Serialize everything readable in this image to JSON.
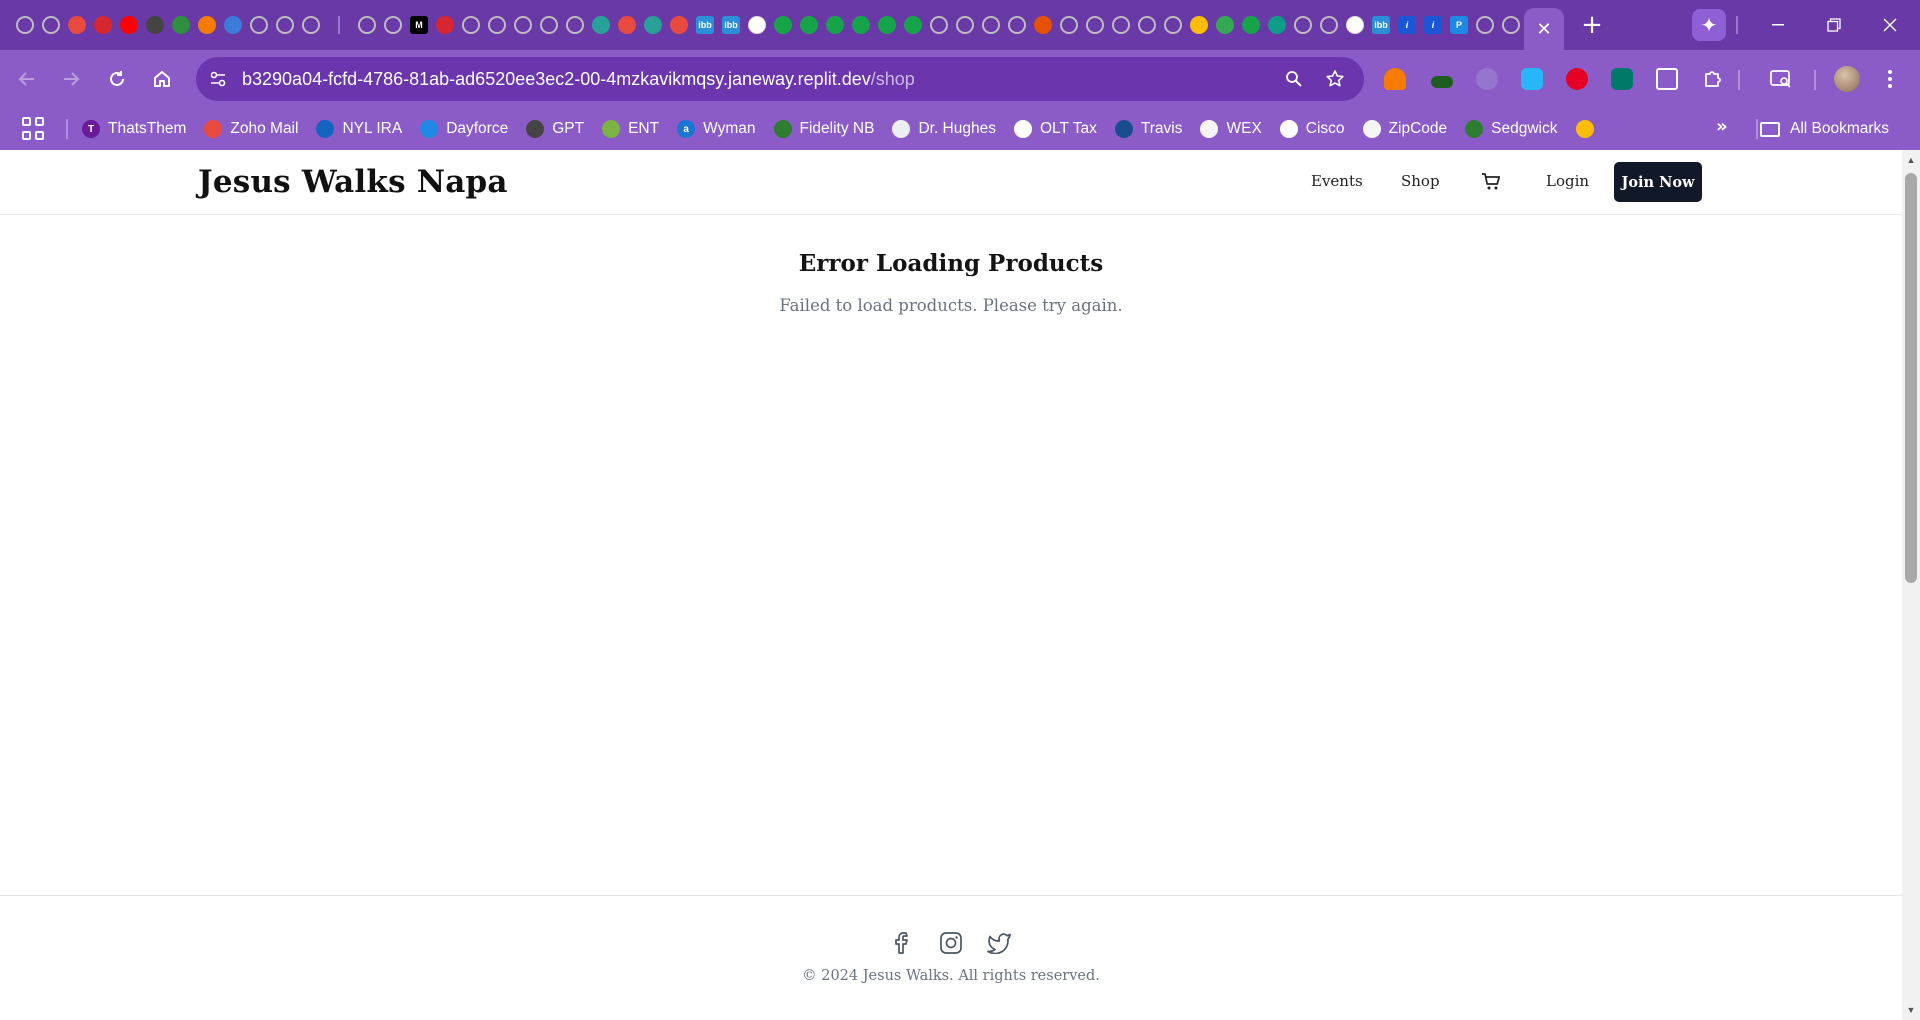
{
  "browser": {
    "tab_favicons": [
      {
        "icon": "chrome-icon",
        "color": "#8a8a8a"
      },
      {
        "icon": "chrome-icon",
        "color": "#8a8a8a"
      },
      {
        "icon": "zoho-mail-icon",
        "color": "#e94a3f"
      },
      {
        "icon": "nascar-icon",
        "color": "#d8262e"
      },
      {
        "icon": "youtube-icon",
        "color": "#ff0000"
      },
      {
        "icon": "diamond-icon",
        "color": "#444444"
      },
      {
        "icon": "shield-icon",
        "color": "#2f8f3e"
      },
      {
        "icon": "star-icon",
        "color": "#f57c00"
      },
      {
        "icon": "globe-icon",
        "color": "#3d7bd9"
      },
      {
        "icon": "chrome-icon",
        "color": "#8a8a8a"
      },
      {
        "icon": "chrome-icon",
        "color": "#8a8a8a"
      },
      {
        "icon": "chrome-icon",
        "color": "#8a8a8a"
      }
    ],
    "tab_favicons_2": [
      {
        "icon": "chrome-icon",
        "color": "#8a8a8a"
      },
      {
        "icon": "chrome-icon",
        "color": "#8a8a8a"
      },
      {
        "icon": "medium-icon",
        "color": "#000000",
        "text": "M"
      },
      {
        "icon": "nascar-icon",
        "color": "#d8262e"
      },
      {
        "icon": "globe-icon",
        "color": "#8a8a8a"
      },
      {
        "icon": "globe-icon",
        "color": "#8a8a8a"
      },
      {
        "icon": "globe-icon",
        "color": "#8a8a8a"
      },
      {
        "icon": "globe-icon",
        "color": "#8a8a8a"
      },
      {
        "icon": "globe-icon",
        "color": "#8a8a8a"
      },
      {
        "icon": "shield-icon",
        "color": "#2aa198"
      },
      {
        "icon": "zoho-mail-icon",
        "color": "#e94a3f"
      },
      {
        "icon": "shield-icon",
        "color": "#2aa198"
      },
      {
        "icon": "zoho-mail-icon",
        "color": "#e94a3f"
      },
      {
        "icon": "ibb-icon",
        "color": "#2a8fd6",
        "text": "ibb"
      },
      {
        "icon": "ibb-icon",
        "color": "#2a8fd6",
        "text": "ibb"
      },
      {
        "icon": "flickr-icon",
        "color": "#ffffff"
      },
      {
        "icon": "arrow-icon",
        "color": "#17a34a"
      },
      {
        "icon": "arrow-icon",
        "color": "#17a34a"
      },
      {
        "icon": "arrow-icon",
        "color": "#17a34a"
      },
      {
        "icon": "arrow-icon",
        "color": "#17a34a"
      },
      {
        "icon": "arrow-icon",
        "color": "#17a34a"
      },
      {
        "icon": "arrow-icon",
        "color": "#17a34a"
      },
      {
        "icon": "globe-icon",
        "color": "#8a8a8a"
      },
      {
        "icon": "globe-icon",
        "color": "#8a8a8a"
      },
      {
        "icon": "globe-icon",
        "color": "#8a8a8a"
      },
      {
        "icon": "globe-icon",
        "color": "#8a8a8a"
      },
      {
        "icon": "dots-icon",
        "color": "#e65100"
      },
      {
        "icon": "globe-icon",
        "color": "#8a8a8a"
      },
      {
        "icon": "globe-icon",
        "color": "#8a8a8a"
      },
      {
        "icon": "chrome-icon",
        "color": "#8a8a8a"
      },
      {
        "icon": "chrome-icon",
        "color": "#8a8a8a"
      },
      {
        "icon": "chrome-icon",
        "color": "#8a8a8a"
      },
      {
        "icon": "pinwheel-icon",
        "color": "#fbbc05"
      },
      {
        "icon": "pinwheel-icon",
        "color": "#34a853"
      },
      {
        "icon": "arrow-icon",
        "color": "#17a34a"
      },
      {
        "icon": "ring-icon",
        "color": "#0f9d8a"
      },
      {
        "icon": "globe-icon",
        "color": "#8a8a8a"
      },
      {
        "icon": "chrome-icon",
        "color": "#8a8a8a"
      },
      {
        "icon": "flickr-icon",
        "color": "#ffffff"
      },
      {
        "icon": "ibb-icon",
        "color": "#2a8fd6",
        "text": "ibb"
      },
      {
        "icon": "info-icon",
        "color": "#1a56d6",
        "text": "i"
      },
      {
        "icon": "info-icon",
        "color": "#1a56d6",
        "text": "i"
      },
      {
        "icon": "p-icon",
        "color": "#1e88e5",
        "text": "P"
      },
      {
        "icon": "globe-icon",
        "color": "#8a8a8a"
      },
      {
        "icon": "globe-icon",
        "color": "#8a8a8a"
      }
    ],
    "active_tab_close": "✕",
    "new_tab": "+",
    "url_host": "b3290a04-fcfd-4786-81ab-ad6520ee3ec2-00-4mzkavikmqsy.janeway.replit.dev",
    "url_path": "/shop",
    "bookmarks": [
      {
        "label": "ThatsThem",
        "icon": "thatsthem-icon",
        "color": "#6a1b9a",
        "glyph": "T"
      },
      {
        "label": "Zoho Mail",
        "icon": "zoho-mail-icon",
        "color": "#e94a3f",
        "glyph": ""
      },
      {
        "label": "NYL IRA",
        "icon": "nyl-icon",
        "color": "#1565c0",
        "glyph": ""
      },
      {
        "label": "Dayforce",
        "icon": "dayforce-icon",
        "color": "#1e88e5",
        "glyph": ""
      },
      {
        "label": "GPT",
        "icon": "openai-icon",
        "color": "#444444",
        "glyph": ""
      },
      {
        "label": "ENT",
        "icon": "ent-icon",
        "color": "#7cb342",
        "glyph": ""
      },
      {
        "label": "Wyman",
        "icon": "wyman-icon",
        "color": "#1976d2",
        "glyph": "a"
      },
      {
        "label": "Fidelity NB",
        "icon": "fidelity-icon",
        "color": "#2e7d32",
        "glyph": ""
      },
      {
        "label": "Dr. Hughes",
        "icon": "document-icon",
        "color": "#eceff1",
        "glyph": ""
      },
      {
        "label": "OLT Tax",
        "icon": "olt-icon",
        "color": "#ffffff",
        "glyph": ""
      },
      {
        "label": "Travis",
        "icon": "travis-icon",
        "color": "#1a4d8f",
        "glyph": ""
      },
      {
        "label": "WEX",
        "icon": "globe-icon",
        "color": "#8a8a8a",
        "glyph": ""
      },
      {
        "label": "Cisco",
        "icon": "cisco-icon",
        "color": "#ffffff",
        "glyph": ""
      },
      {
        "label": "ZipCode",
        "icon": "globe-icon",
        "color": "#8a8a8a",
        "glyph": ""
      },
      {
        "label": "Sedgwick",
        "icon": "sedgwick-icon",
        "color": "#2e7d32",
        "glyph": ""
      },
      {
        "label": "",
        "icon": "photos-icon",
        "color": "#fbbc05",
        "glyph": ""
      }
    ],
    "all_bookmarks": "All Bookmarks",
    "bookmarks_more": "»"
  },
  "site": {
    "brand": "Jesus Walks Napa",
    "nav": {
      "events": "Events",
      "shop": "Shop",
      "login": "Login",
      "join": "Join Now"
    },
    "error_title": "Error Loading Products",
    "error_message": "Failed to load products. Please try again.",
    "footer": {
      "copyright": "© 2024 Jesus Walks. All rights reserved."
    }
  },
  "colors": {
    "tabstrip": "#6a39a8",
    "toolbar": "#8b5cc8",
    "join_button": "#111827"
  }
}
